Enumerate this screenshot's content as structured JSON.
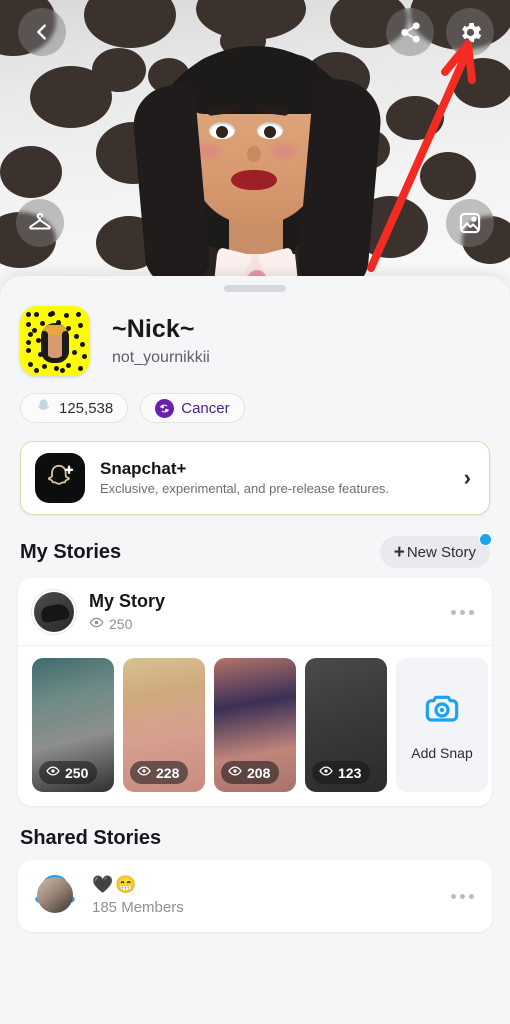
{
  "header": {
    "back_label": "Back",
    "share_label": "Share profile",
    "settings_label": "Settings",
    "outfit_label": "Change outfit",
    "media_label": "Change background"
  },
  "annotation": {
    "color": "#f42b22",
    "points_to": "settings-gear-button"
  },
  "profile": {
    "display_name": "~Nick~",
    "username": "not_yournikkii",
    "snapscore": "125,538",
    "zodiac": "Cancer",
    "zodiac_color": "#6b1fb1",
    "snapcode_color": "#fffc00"
  },
  "snapchat_plus": {
    "title": "Snapchat+",
    "subtitle": "Exclusive, experimental, and pre-release features.",
    "chevron": "›",
    "border_color": "#e3d9a8"
  },
  "my_stories": {
    "heading": "My Stories",
    "new_story_label": "New Story",
    "new_story_plus": "+",
    "badge_color": "#1aa3f0",
    "story": {
      "title": "My Story",
      "views": "250",
      "more_label": "More options"
    },
    "snaps": [
      {
        "views": "250",
        "bg": "linear-gradient(165deg,#3f6b6d 0%,#6e8a86 30%,#8d8f8c 60%,#2e2f31 100%)"
      },
      {
        "views": "228",
        "bg": "linear-gradient(170deg,#d8c191 0%,#cfa97e 28%,#d79f90 58%,#c78b7e 100%)"
      },
      {
        "views": "208",
        "bg": "linear-gradient(170deg,#b5736a 0%,#3a2f55 35%,#c0857a 70%,#a8736c 100%)"
      },
      {
        "views": "123",
        "bg": "linear-gradient(160deg,#4a4a4a 0%,#3a3a3a 45%,#2b2b2b 100%)"
      }
    ],
    "add_snap": {
      "label": "Add Snap",
      "icon_color": "#1aa3f0"
    }
  },
  "shared_stories": {
    "heading": "Shared Stories",
    "item": {
      "emojis": "🖤😁",
      "members": "185 Members",
      "more_label": "More options",
      "ring_color": "#1aa3f0"
    }
  }
}
